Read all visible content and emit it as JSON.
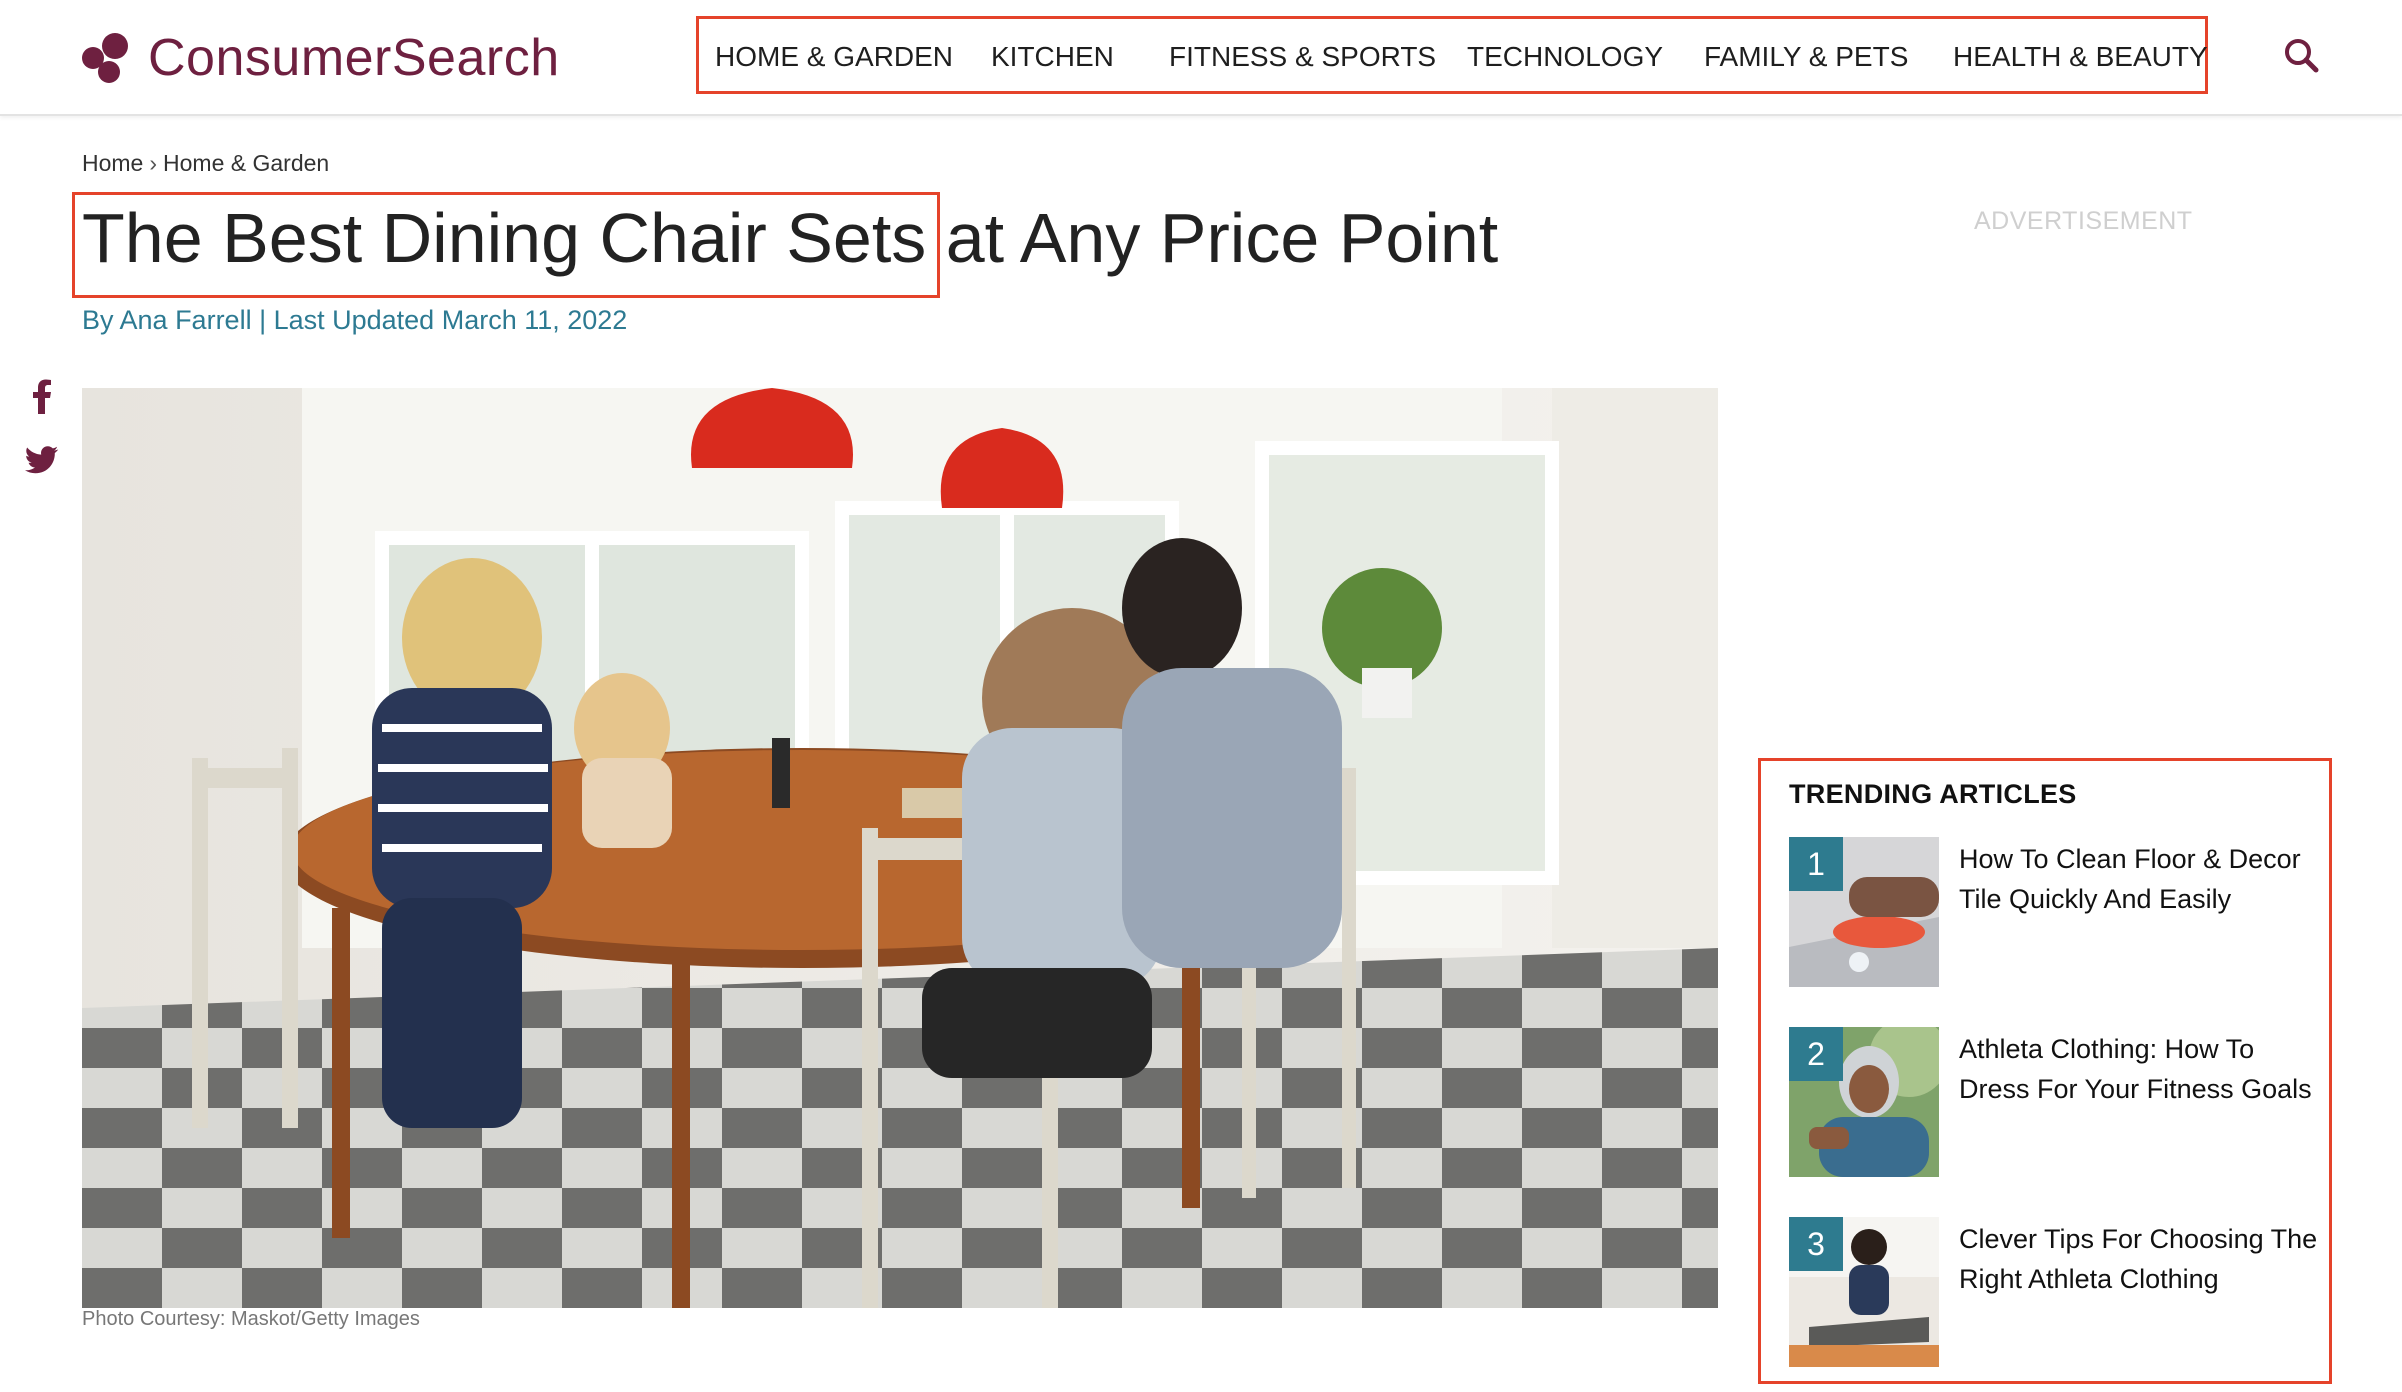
{
  "brand": {
    "name": "ConsumerSearch",
    "color": "#6e2040"
  },
  "nav": {
    "items": [
      "HOME & GARDEN",
      "KITCHEN",
      "FITNESS & SPORTS",
      "TECHNOLOGY",
      "FAMILY & PETS",
      "HEALTH & BEAUTY"
    ],
    "search_icon": "search-icon"
  },
  "breadcrumb": {
    "home": "Home",
    "separator": "›",
    "current": "Home & Garden"
  },
  "article": {
    "title_highlight": "The Best Dining Chair Sets",
    "title_rest": "at Any Price Point",
    "byline": "By Ana Farrell | Last Updated March 11, 2022",
    "caption": "Photo Courtesy: Maskot/Getty Images"
  },
  "ad": {
    "label": "ADVERTISEMENT"
  },
  "social": [
    "facebook-icon",
    "twitter-icon"
  ],
  "trending": {
    "heading": "TRENDING ARTICLES",
    "items": [
      {
        "num": "1",
        "title": "How To Clean Floor & Decor Tile Quickly And Easily"
      },
      {
        "num": "2",
        "title": "Athleta Clothing: How To Dress For Your Fitness Goals"
      },
      {
        "num": "3",
        "title": "Clever Tips For Choosing The Right Athleta Clothing"
      }
    ]
  },
  "colors": {
    "highlight_box": "#e5432a",
    "byline": "#2d7a92",
    "badge": "#2e7b8f"
  }
}
